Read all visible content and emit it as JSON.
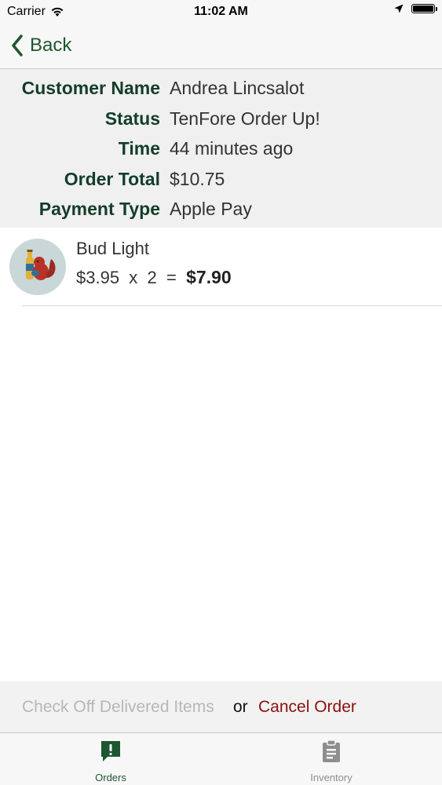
{
  "status_bar": {
    "carrier": "Carrier",
    "time": "11:02 AM"
  },
  "nav": {
    "back_label": "Back"
  },
  "details": [
    {
      "label": "Customer Name",
      "value": "Andrea Lincsalot"
    },
    {
      "label": "Status",
      "value": "TenFore Order Up!"
    },
    {
      "label": "Time",
      "value": "44 minutes ago"
    },
    {
      "label": "Order Total",
      "value": "$10.75"
    },
    {
      "label": "Payment Type",
      "value": "Apple Pay"
    }
  ],
  "line_items": [
    {
      "name": "Bud Light",
      "unit_price": "$3.95",
      "times": "x",
      "quantity": "2",
      "equals": "=",
      "total": "$7.90"
    }
  ],
  "actions": {
    "check_off_label": "Check Off Delivered Items",
    "or_label": "or",
    "cancel_label": "Cancel Order"
  },
  "tabs": [
    {
      "label": "Orders",
      "icon": "orders-alert-icon",
      "active": true
    },
    {
      "label": "Inventory",
      "icon": "clipboard-icon",
      "active": false
    }
  ],
  "colors": {
    "brand_green": "#1e5631",
    "cancel_red": "#8a1010",
    "disabled_gray": "#b7b7b7"
  }
}
